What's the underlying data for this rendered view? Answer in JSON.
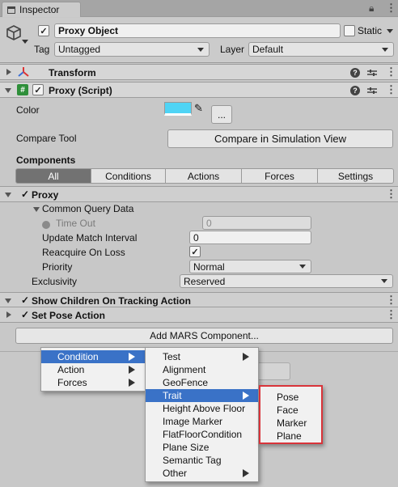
{
  "window": {
    "tab_title": "Inspector"
  },
  "header": {
    "object_name": "Proxy Object",
    "static_label": "Static",
    "tag_label": "Tag",
    "tag_value": "Untagged",
    "layer_label": "Layer",
    "layer_value": "Default"
  },
  "transform": {
    "title": "Transform"
  },
  "proxy_script": {
    "title": "Proxy (Script)",
    "color_label": "Color",
    "color_value": "#4fd4f5",
    "ellipsis_label": "...",
    "compare_tool_label": "Compare Tool",
    "compare_button": "Compare in Simulation View",
    "components_label": "Components",
    "filter_tabs": [
      "All",
      "Conditions",
      "Actions",
      "Forces",
      "Settings"
    ]
  },
  "proxy_section": {
    "title": "Proxy",
    "common_query_data": "Common Query Data",
    "time_out_label": "Time Out",
    "time_out_value": "0",
    "update_match_interval_label": "Update Match Interval",
    "update_match_interval_value": "0",
    "reacquire_label": "Reacquire On Loss",
    "priority_label": "Priority",
    "priority_value": "Normal",
    "exclusivity_label": "Exclusivity",
    "exclusivity_value": "Reserved"
  },
  "show_children": {
    "title": "Show Children On Tracking Action"
  },
  "set_pose": {
    "title": "Set Pose Action"
  },
  "add_component_button": "Add MARS Component...",
  "menu_level1": [
    "Condition",
    "Action",
    "Forces"
  ],
  "menu_level2": [
    "Test",
    "Alignment",
    "GeoFence",
    "Trait",
    "Height Above Floor",
    "Image Marker",
    "FlatFloorCondition",
    "Plane Size",
    "Semantic Tag",
    "Other"
  ],
  "menu_level3": [
    "Pose",
    "Face",
    "Marker",
    "Plane"
  ],
  "colors": {
    "selection": "#3a72c7",
    "highlight_border": "#d9343a",
    "active_tab": "#727272"
  }
}
